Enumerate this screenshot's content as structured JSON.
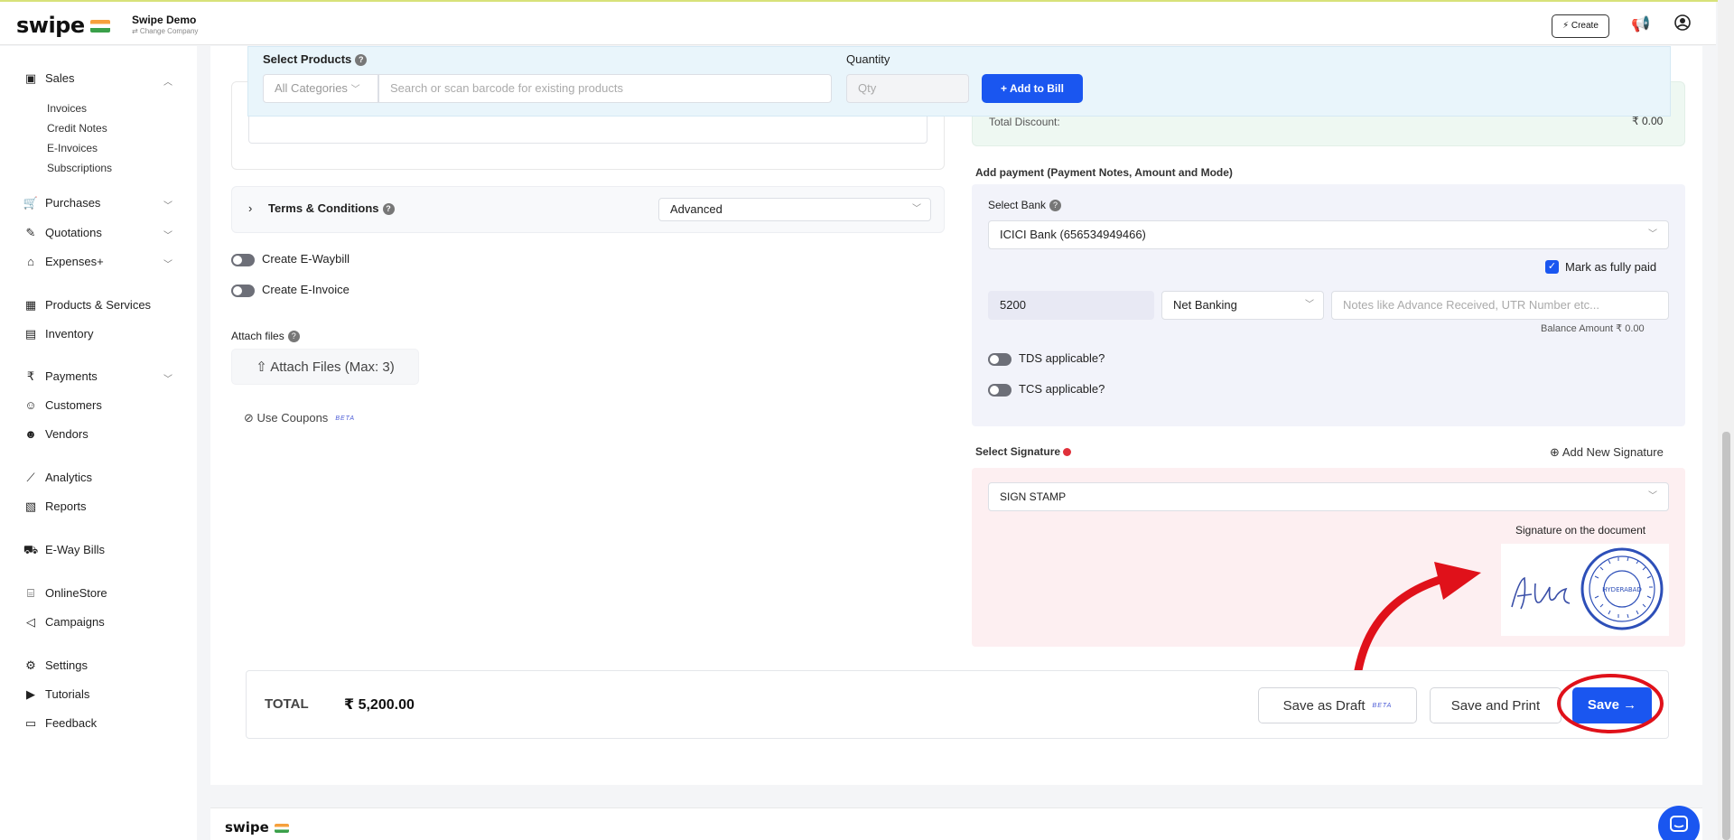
{
  "header": {
    "logo": "swipe",
    "company_name": "Swipe Demo",
    "company_action": "⇄ Change Company",
    "create_label": "⚡ Create"
  },
  "sidebar": {
    "sales": "Sales",
    "sales_sub": [
      "Invoices",
      "Credit Notes",
      "E-Invoices",
      "Subscriptions"
    ],
    "purchases": "Purchases",
    "quotations": "Quotations",
    "expenses": "Expenses+",
    "products": "Products & Services",
    "inventory": "Inventory",
    "payments": "Payments",
    "customers": "Customers",
    "vendors": "Vendors",
    "analytics": "Analytics",
    "reports": "Reports",
    "eway": "E-Way Bills",
    "onlinestore": "OnlineStore",
    "campaigns": "Campaigns",
    "settings": "Settings",
    "tutorials": "Tutorials",
    "feedback": "Feedback"
  },
  "products": {
    "label": "Select Products",
    "quantity_label": "Quantity",
    "category_value": "All Categories",
    "search_placeholder": "Search or scan barcode for existing products",
    "qty_placeholder": "Qty",
    "add_button": "+ Add to Bill"
  },
  "summary": {
    "total_discount_label": "Total Discount:",
    "total_discount_value": "₹ 0.00"
  },
  "left": {
    "terms_label": "Terms & Conditions",
    "terms_select": "Advanced",
    "eway_toggle": "Create E-Waybill",
    "einvoice_toggle": "Create E-Invoice",
    "attach_label": "Attach files",
    "attach_button": "Attach Files (Max: 3)",
    "coupons": "Use Coupons",
    "beta": "BETA"
  },
  "payment": {
    "section_label": "Add payment (Payment Notes, Amount and Mode)",
    "bank_label": "Select Bank",
    "bank_value": "ICICI Bank (656534949466)",
    "fully_paid": "Mark as fully paid",
    "amount": "5200",
    "mode": "Net Banking",
    "notes_placeholder": "Notes like Advance Received, UTR Number etc...",
    "balance": "Balance Amount  ₹ 0.00",
    "tds": "TDS applicable?",
    "tcs": "TCS applicable?"
  },
  "signature": {
    "label": "Select Signature",
    "add_new": "Add New Signature",
    "value": "SIGN STAMP",
    "doc_label": "Signature on the document",
    "stamp_text": "HYDERABAD"
  },
  "totals": {
    "label": "TOTAL",
    "value": "₹ 5,200.00",
    "save_draft": "Save as Draft",
    "beta": "BETA",
    "save_print": "Save and Print",
    "save": "Save →"
  },
  "footer": {
    "logo": "swipe"
  },
  "colors": {
    "accent": "#1a56f0",
    "annotation": "#e0111a"
  }
}
